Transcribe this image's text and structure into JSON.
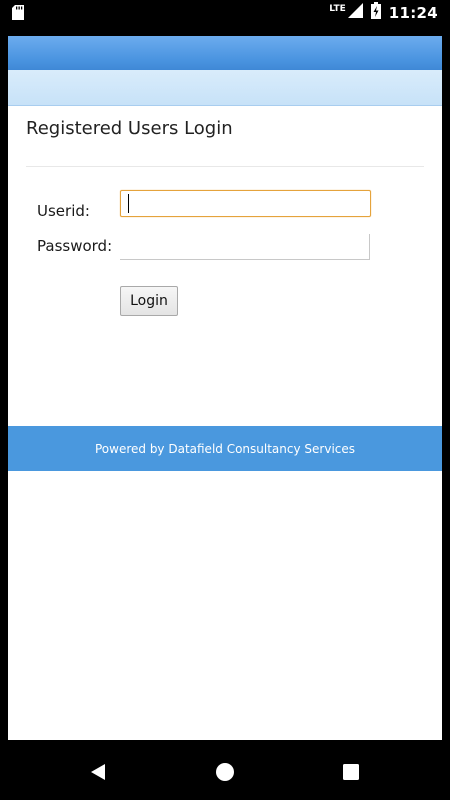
{
  "status_bar": {
    "network": "LTE",
    "time": "11:24",
    "icons": [
      "sd-card-icon",
      "signal-icon",
      "battery-charging-icon"
    ]
  },
  "login": {
    "title": "Registered Users Login",
    "userid_label": "Userid:",
    "userid_value": "",
    "password_label": "Password:",
    "password_value": "",
    "button_label": "Login"
  },
  "footer": {
    "text": "Powered by Datafield Consultancy Services"
  },
  "navigation": {
    "buttons": [
      "back-icon",
      "home-icon",
      "recents-icon"
    ]
  },
  "colors": {
    "header_blue": "#4a94e0",
    "subheader_light_blue": "#c7e2f8",
    "footer_blue": "#4a98de",
    "focus_orange": "#e5a33c"
  }
}
